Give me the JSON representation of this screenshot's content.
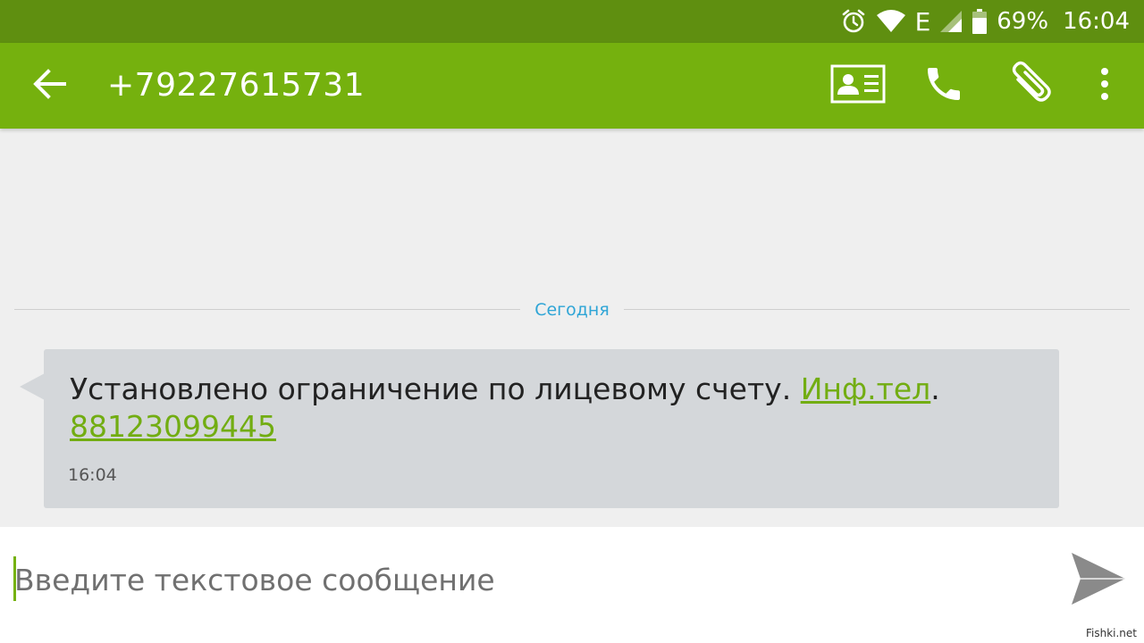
{
  "status_bar": {
    "network": "E",
    "battery_percent": "69%",
    "time": "16:04",
    "icons": [
      "alarm-icon",
      "wifi-icon",
      "signal-icon",
      "battery-icon"
    ]
  },
  "app_bar": {
    "title": "+79227615731",
    "icons": [
      "back-arrow-icon",
      "contact-card-icon",
      "phone-icon",
      "paperclip-icon",
      "more-vert-icon"
    ]
  },
  "conversation": {
    "date_divider": "Сегодня",
    "messages": [
      {
        "text_before": "Установлено ограничение по лицевому счету. ",
        "link1": "Инф.тел",
        "text_mid": ".",
        "link2": "88123099445",
        "time": "16:04"
      }
    ]
  },
  "composer": {
    "placeholder": "Введите текстовое сообщение",
    "value": "",
    "send_icon": "send-icon"
  },
  "watermark": "Fishki.net",
  "colors": {
    "status_bar": "#5f8f10",
    "app_bar": "#75b10e",
    "link": "#72ad12",
    "date_label": "#2fa5d6",
    "bubble": "#d4d7da",
    "background": "#efefef"
  }
}
